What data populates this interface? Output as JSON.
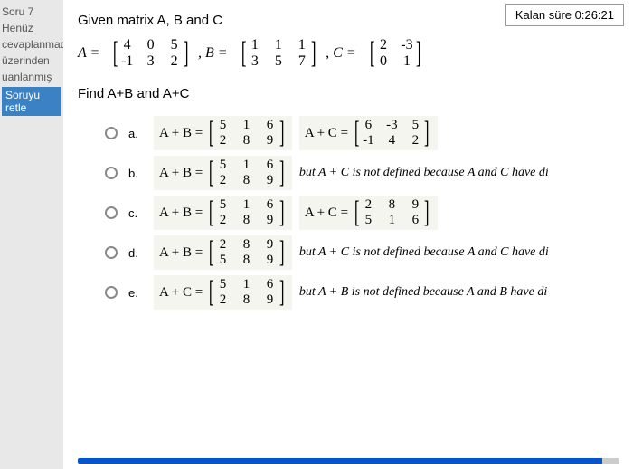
{
  "sidebar": {
    "items": [
      "Soru 7",
      "Henüz",
      "cevaplanmadı",
      "üzerinden",
      "uanlanmış",
      "Soruyu",
      "retle"
    ]
  },
  "timer": {
    "label": "Kalan süre 0:26:21"
  },
  "question": {
    "given": "Given matrix A, B and C",
    "find": "Find A+B and A+C"
  },
  "matrices": {
    "A": {
      "label": "A =",
      "rows": [
        [
          "4",
          "0",
          "5"
        ],
        [
          "-1",
          "3",
          "2"
        ]
      ]
    },
    "B": {
      "label": ", B =",
      "rows": [
        [
          "1",
          "1",
          "1"
        ],
        [
          "3",
          "5",
          "7"
        ]
      ]
    },
    "C": {
      "label": ", C =",
      "rows": [
        [
          "2",
          "-3"
        ],
        [
          "0",
          "1"
        ]
      ]
    }
  },
  "options": {
    "a": {
      "label": "a.",
      "ab_label": "A + B =",
      "ab": [
        [
          "5",
          "1",
          "6"
        ],
        [
          "2",
          "8",
          "9"
        ]
      ],
      "ac_label": "A + C =",
      "ac": [
        [
          "6",
          "-3",
          "5"
        ],
        [
          "-1",
          "4",
          "2"
        ]
      ]
    },
    "b": {
      "label": "b.",
      "ab_label": "A + B =",
      "ab": [
        [
          "5",
          "1",
          "6"
        ],
        [
          "2",
          "8",
          "9"
        ]
      ],
      "explain": "but A + C is not defined because A and C have di"
    },
    "c": {
      "label": "c.",
      "ab_label": "A + B =",
      "ab": [
        [
          "5",
          "1",
          "6"
        ],
        [
          "2",
          "8",
          "9"
        ]
      ],
      "ac_label": "A + C =",
      "ac": [
        [
          "2",
          "8",
          "9"
        ],
        [
          "5",
          "1",
          "6"
        ]
      ]
    },
    "d": {
      "label": "d.",
      "ab_label": "A + B =",
      "ab": [
        [
          "2",
          "8",
          "9"
        ],
        [
          "5",
          "8",
          "9"
        ]
      ],
      "explain": "but A + C is not defined because A and C have di"
    },
    "e": {
      "label": "e.",
      "ac_label": "A + C =",
      "ac": [
        [
          "5",
          "1",
          "6"
        ],
        [
          "2",
          "8",
          "9"
        ]
      ],
      "explain": "but A + B is not defined because A and B have di"
    }
  }
}
